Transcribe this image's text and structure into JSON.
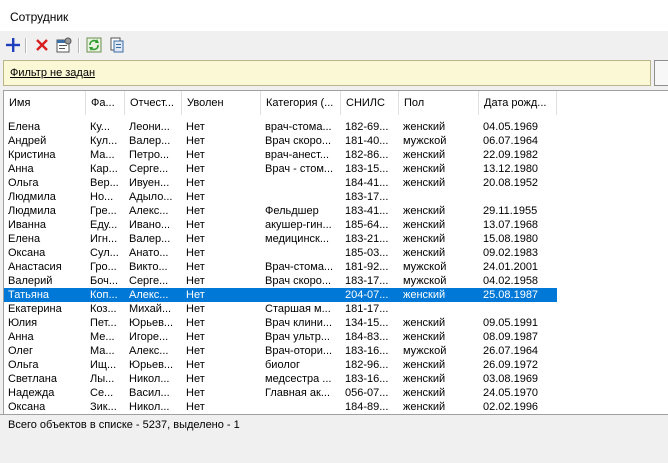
{
  "window": {
    "title": "Сотрудник"
  },
  "toolbar": {
    "buttons": [
      {
        "name": "add-button",
        "icon": "plus-icon",
        "color": "#1f3fbf"
      },
      {
        "name": "delete-button",
        "icon": "red-x-icon",
        "color": "#d81e1e"
      },
      {
        "name": "properties-button",
        "icon": "properties-icon"
      },
      {
        "name": "refresh-button",
        "icon": "refresh-icon",
        "color": "#2e9a2e"
      },
      {
        "name": "export-button",
        "icon": "export-icon"
      }
    ]
  },
  "filter": {
    "label": "Фильтр не задан"
  },
  "table": {
    "columns": [
      "Имя",
      "Фа...",
      "Отчест...",
      "Уволен",
      "Категория (...",
      "СНИЛС",
      "Пол",
      "Дата рожд..."
    ],
    "rows": [
      [
        "Елена",
        "Ку...",
        "Леони...",
        "Нет",
        "врач-стома...",
        "182-69...",
        "женский",
        "04.05.1969"
      ],
      [
        "Андрей",
        "Кул...",
        "Валер...",
        "Нет",
        "Врач скоро...",
        "181-40...",
        "мужской",
        "06.07.1964"
      ],
      [
        "Кристина",
        "Ма...",
        "Петро...",
        "Нет",
        "врач-анест...",
        "182-86...",
        "женский",
        "22.09.1982"
      ],
      [
        "Анна",
        "Кар...",
        "Серге...",
        "Нет",
        "Врач - стом...",
        "183-15...",
        "женский",
        "13.12.1980"
      ],
      [
        "Ольга",
        "Вер...",
        "Ивуен...",
        "Нет",
        "",
        "184-41...",
        "женский",
        "20.08.1952"
      ],
      [
        "Людмила",
        "Но...",
        "Адыло...",
        "Нет",
        "",
        "183-17...",
        "",
        ""
      ],
      [
        "Людмила",
        "Гре...",
        "Алекс...",
        "Нет",
        "Фельдшер",
        "183-41...",
        "женский",
        "29.11.1955"
      ],
      [
        "Иванна",
        "Еду...",
        "Ивано...",
        "Нет",
        "акушер-гин...",
        "185-64...",
        "женский",
        "13.07.1968"
      ],
      [
        "Елена",
        "Игн...",
        "Валер...",
        "Нет",
        "медицинск...",
        "183-21...",
        "женский",
        "15.08.1980"
      ],
      [
        "Оксана",
        "Сул...",
        "Анато...",
        "Нет",
        "",
        "185-03...",
        "женский",
        "09.02.1983"
      ],
      [
        "Анастасия",
        "Гро...",
        "Викто...",
        "Нет",
        "Врач-стома...",
        "181-92...",
        "мужской",
        "24.01.2001"
      ],
      [
        "Валерий",
        "Боч...",
        "Серге...",
        "Нет",
        "Врач скоро...",
        "183-17...",
        "мужской",
        "04.02.1958"
      ],
      [
        "Татьяна",
        "Коп...",
        "Алекс...",
        "Нет",
        "",
        "204-07...",
        "женский",
        "25.08.1987"
      ],
      [
        "Екатерина",
        "Коз...",
        "Михай...",
        "Нет",
        "Старшая м...",
        "181-17...",
        "",
        ""
      ],
      [
        "Юлия",
        "Пет...",
        "Юрьев...",
        "Нет",
        "Врач клини...",
        "134-15...",
        "женский",
        "09.05.1991"
      ],
      [
        "Анна",
        "Ме...",
        "Игоре...",
        "Нет",
        "Врач ультр...",
        "184-83...",
        "женский",
        "08.09.1987"
      ],
      [
        "Олег",
        "Ма...",
        "Алекс...",
        "Нет",
        "Врач-отори...",
        "183-16...",
        "мужской",
        "26.07.1964"
      ],
      [
        "Ольга",
        "Ищ...",
        "Юрьев...",
        "Нет",
        "биолог",
        "182-96...",
        "женский",
        "26.09.1972"
      ],
      [
        "Светлана",
        "Лы...",
        "Никол...",
        "Нет",
        "медсестра ...",
        "183-16...",
        "женский",
        "03.08.1969"
      ],
      [
        "Надежда",
        "Се...",
        "Васил...",
        "Нет",
        "Главная ак...",
        "056-07...",
        "женский",
        "24.05.1970"
      ],
      [
        "Оксана",
        "Зик...",
        "Никол...",
        "Нет",
        "",
        "184-89...",
        "женский",
        "02.02.1996"
      ]
    ],
    "selected_row": 12,
    "selection_color": "#0078d7"
  },
  "status": {
    "text": "Всего объектов в списке - 5237, выделено - 1"
  }
}
